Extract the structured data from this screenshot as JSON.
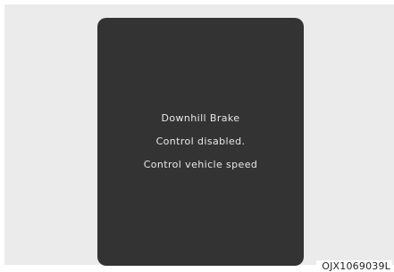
{
  "display": {
    "message_lines": [
      "Downhill Brake",
      "Control disabled.",
      "Control vehicle speed"
    ]
  },
  "figure_code": "OJX1069039L",
  "colors": {
    "backdrop": "#ebebeb",
    "screen": "#333333",
    "text": "#e8e8e8"
  }
}
